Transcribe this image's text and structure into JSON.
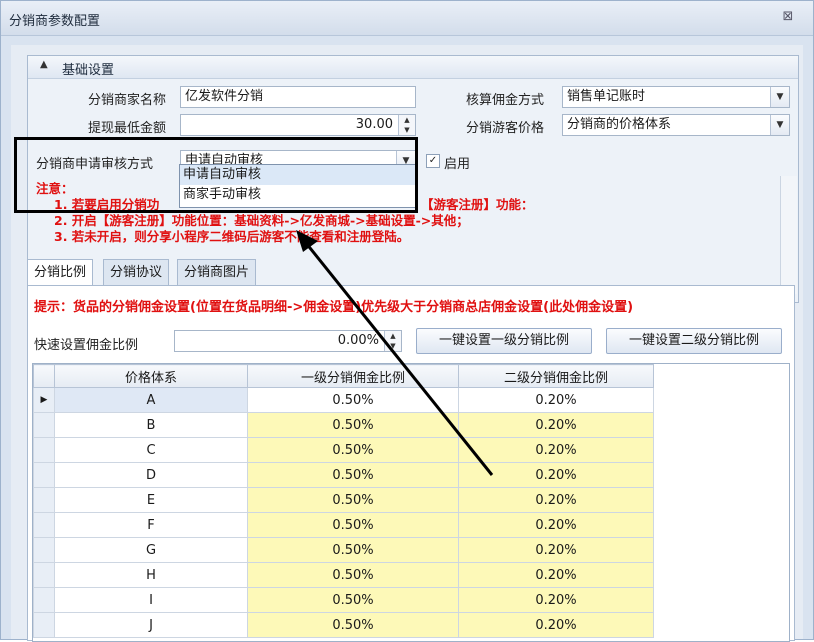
{
  "window": {
    "title": "分销商参数配置",
    "close_glyph": "⊠"
  },
  "basic": {
    "title": "基础设置",
    "fields": {
      "name_label": "分销商家名称",
      "name_value": "亿发软件分销",
      "min_label": "提现最低金额",
      "min_value": "30.00",
      "calc_label": "核算佣金方式",
      "calc_value": "销售单记账时",
      "guest_label": "分销游客价格",
      "guest_value": "分销商的价格体系",
      "review_label": "分销商申请审核方式",
      "review_value": "申请自动审核",
      "enable_label": "启用",
      "enable_checked": "✓"
    },
    "review_options": [
      "申请自动审核",
      "商家手动审核"
    ],
    "notes": [
      "注意：",
      "1. 若要启用分销功",
      "【游客注册】功能：",
      "2. 开启【游客注册】功能位置：基础资料->亿发商城->基础设置->其他；",
      "3. 若未开启，则分享小程序二维码后游客不能查看和注册登陆。"
    ]
  },
  "tabs": [
    "分销比例",
    "分销协议",
    "分销商图片"
  ],
  "tabpanel": {
    "tip": "提示：货品的分销佣金设置(位置在货品明细->佣金设置)优先级大于分销商总店佣金设置(此处佣金设置)",
    "quick_label": "快速设置佣金比例",
    "quick_value": "0.00%",
    "btn_level1": "一键设置一级分销比例",
    "btn_level2": "一键设置二级分销比例"
  },
  "grid": {
    "columns": [
      "价格体系",
      "一级分销佣金比例",
      "二级分销佣金比例"
    ],
    "rows": [
      {
        "name": "A",
        "l1": "0.50%",
        "l2": "0.20%"
      },
      {
        "name": "B",
        "l1": "0.50%",
        "l2": "0.20%"
      },
      {
        "name": "C",
        "l1": "0.50%",
        "l2": "0.20%"
      },
      {
        "name": "D",
        "l1": "0.50%",
        "l2": "0.20%"
      },
      {
        "name": "E",
        "l1": "0.50%",
        "l2": "0.20%"
      },
      {
        "name": "F",
        "l1": "0.50%",
        "l2": "0.20%"
      },
      {
        "name": "G",
        "l1": "0.50%",
        "l2": "0.20%"
      },
      {
        "name": "H",
        "l1": "0.50%",
        "l2": "0.20%"
      },
      {
        "name": "I",
        "l1": "0.50%",
        "l2": "0.20%"
      },
      {
        "name": "J",
        "l1": "0.50%",
        "l2": "0.20%"
      }
    ],
    "current_row_marker": "▶"
  },
  "icons": {
    "group_collapse": "▲",
    "dropdown": "▼",
    "spin_up": "▲",
    "spin_down": "▼"
  }
}
